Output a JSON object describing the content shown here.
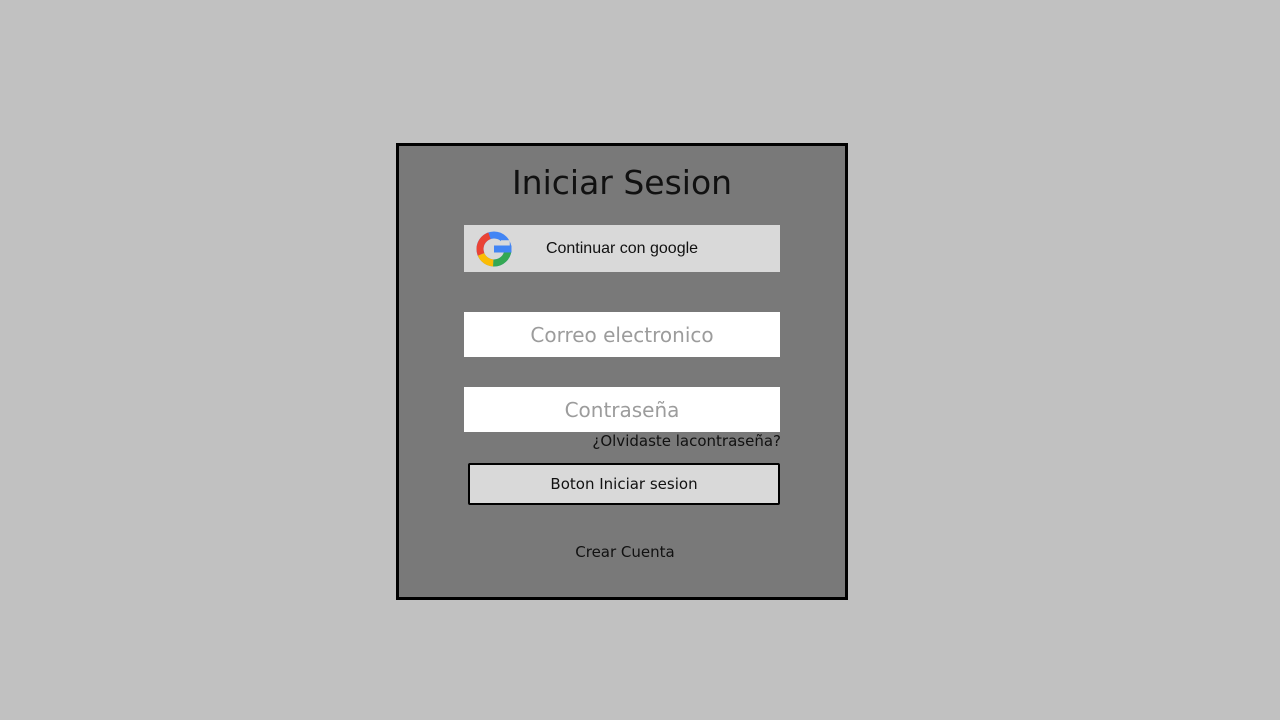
{
  "colors": {
    "page_background": "#c1c1c1",
    "card_background": "#797979",
    "button_background": "#d9d9d9",
    "field_background": "#ffffff",
    "border": "#000000",
    "placeholder": "#9c9c9c",
    "google_blue": "#4285F4",
    "google_red": "#EA4335",
    "google_yellow": "#FBBC05",
    "google_green": "#34A853"
  },
  "login": {
    "title": "Iniciar Sesion",
    "google_button": {
      "icon": "google-g-icon",
      "label": "Continuar con google"
    },
    "email": {
      "value": "",
      "placeholder": "Correo electronico"
    },
    "password": {
      "value": "",
      "placeholder": "Contraseña"
    },
    "forgot_password": "¿Olvidaste lacontraseña?",
    "submit_label": "Boton Iniciar sesion",
    "create_account": "Crear Cuenta"
  }
}
